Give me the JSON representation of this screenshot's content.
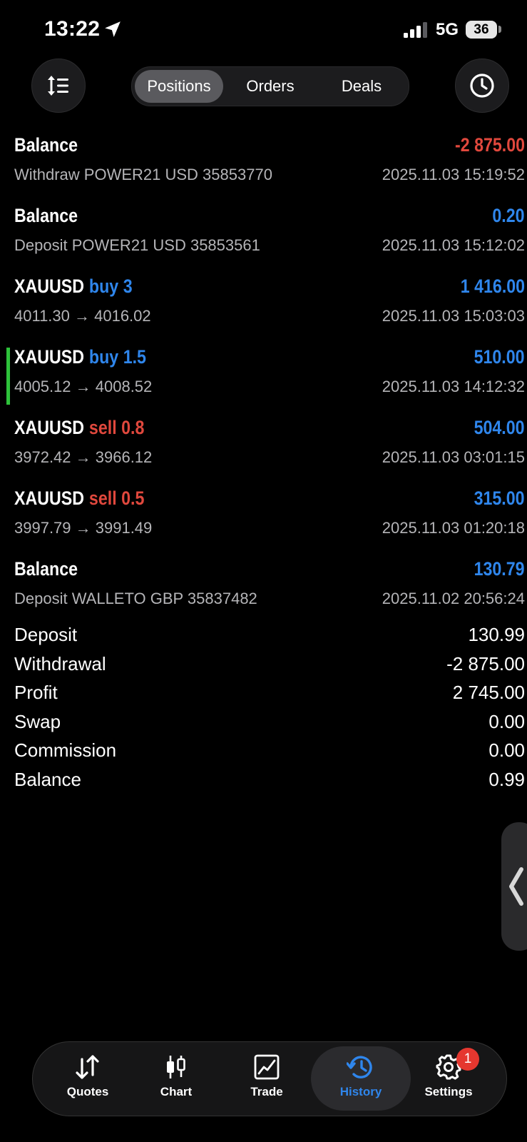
{
  "status_bar": {
    "time": "13:22",
    "network": "5G",
    "battery": "36"
  },
  "segments": [
    {
      "label": "Positions",
      "active": true
    },
    {
      "label": "Orders",
      "active": false
    },
    {
      "label": "Deals",
      "active": false
    }
  ],
  "deals": [
    {
      "symbol": "Balance",
      "side": "",
      "volume": "",
      "amount": "-2 875.00",
      "amount_sign": "negative",
      "description": "Withdraw POWER21 USD 35853770",
      "time": "2025.11.03 15:19:52",
      "highlight": false
    },
    {
      "symbol": "Balance",
      "side": "",
      "volume": "",
      "amount": "0.20",
      "amount_sign": "positive",
      "description": "Deposit POWER21 USD 35853561",
      "time": "2025.11.03 15:12:02",
      "highlight": false
    },
    {
      "symbol": "XAUUSD",
      "side": "buy",
      "volume": "3",
      "amount": "1 416.00",
      "amount_sign": "positive",
      "description": "4011.30 → 4016.02",
      "time": "2025.11.03 15:03:03",
      "highlight": false
    },
    {
      "symbol": "XAUUSD",
      "side": "buy",
      "volume": "1.5",
      "amount": "510.00",
      "amount_sign": "positive",
      "description": "4005.12 → 4008.52",
      "time": "2025.11.03 14:12:32",
      "highlight": true
    },
    {
      "symbol": "XAUUSD",
      "side": "sell",
      "volume": "0.8",
      "amount": "504.00",
      "amount_sign": "positive",
      "description": "3972.42 → 3966.12",
      "time": "2025.11.03 03:01:15",
      "highlight": false
    },
    {
      "symbol": "XAUUSD",
      "side": "sell",
      "volume": "0.5",
      "amount": "315.00",
      "amount_sign": "positive",
      "description": "3997.79 → 3991.49",
      "time": "2025.11.03 01:20:18",
      "highlight": false
    },
    {
      "symbol": "Balance",
      "side": "",
      "volume": "",
      "amount": "130.79",
      "amount_sign": "positive",
      "description": "Deposit WALLETO GBP 35837482",
      "time": "2025.11.02 20:56:24",
      "highlight": false
    }
  ],
  "summary": [
    {
      "label": "Deposit",
      "value": "130.99"
    },
    {
      "label": "Withdrawal",
      "value": "-2 875.00"
    },
    {
      "label": "Profit",
      "value": "2 745.00"
    },
    {
      "label": "Swap",
      "value": "0.00"
    },
    {
      "label": "Commission",
      "value": "0.00"
    },
    {
      "label": "Balance",
      "value": "0.99"
    }
  ],
  "tabs": {
    "quotes": "Quotes",
    "chart": "Chart",
    "trade": "Trade",
    "history": "History",
    "settings": "Settings",
    "settings_badge": "1",
    "active": "history"
  },
  "colors": {
    "buy": "#2f86ec",
    "sell": "#e0483d",
    "positive": "#2f86ec",
    "negative": "#e0483d",
    "highlight_bar": "#2ec23b",
    "badge": "#e5372f"
  },
  "icons": {
    "status": [
      "location-arrow-icon",
      "signal-icon",
      "battery-icon"
    ],
    "header": [
      "sort-icon",
      "clock-icon"
    ],
    "tabs": [
      "quotes-icon",
      "chart-candles-icon",
      "trade-chart-icon",
      "history-icon",
      "gear-icon"
    ],
    "side": "chevron-left-icon"
  }
}
